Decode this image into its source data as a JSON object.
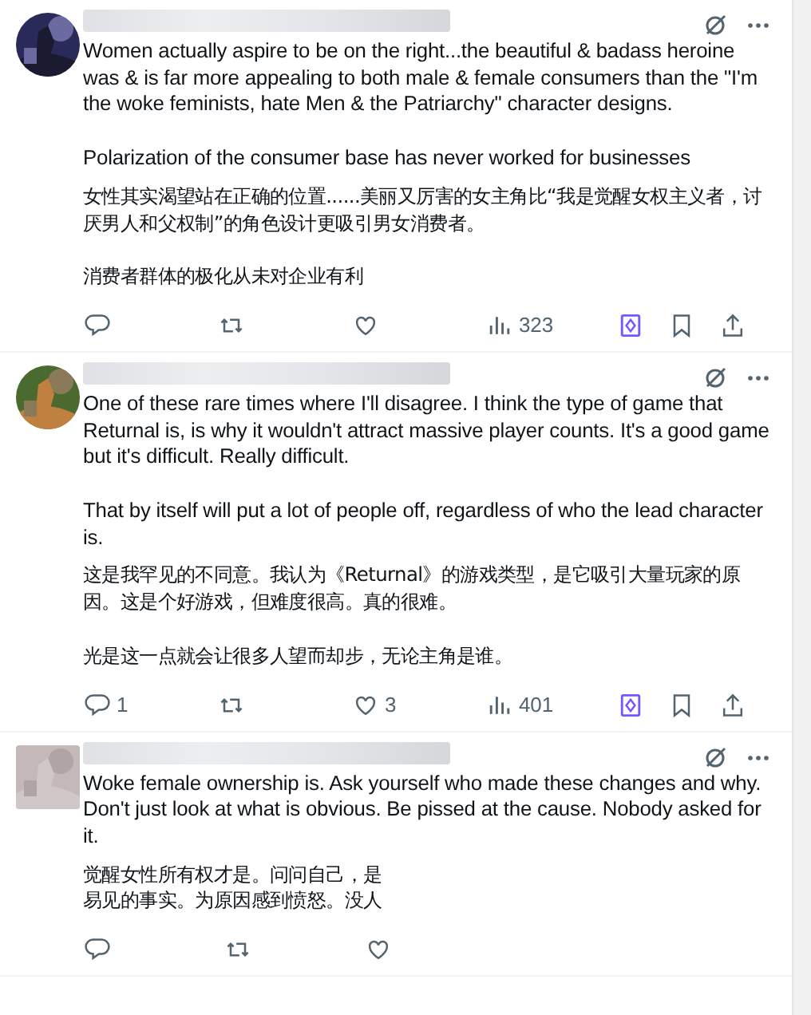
{
  "tweets": [
    {
      "paragraphs": [
        {
          "kind": "en",
          "text": "Women actually aspire to be on the right...the beautiful & badass heroine was & is far more appealing to both male & female consumers than the \"I'm the woke feminists, hate Men & the Patriarchy\" character designs."
        },
        {
          "kind": "en",
          "text": "Polarization of the consumer base has never worked for businesses"
        },
        {
          "kind": "zh",
          "text": "女性其实渴望站在正确的位置......美丽又厉害的女主角比“我是觉醒女权主义者，讨厌男人和父权制”的角色设计更吸引男女消费者。"
        },
        {
          "kind": "zh",
          "text": "消费者群体的极化从未对企业有利"
        }
      ],
      "actions": [
        {
          "kind": "reply"
        },
        {
          "kind": "repost"
        },
        {
          "kind": "like"
        },
        {
          "kind": "views",
          "count": "323"
        },
        {
          "kind": "grok"
        },
        {
          "kind": "bookmark"
        },
        {
          "kind": "share"
        }
      ]
    },
    {
      "paragraphs": [
        {
          "kind": "en",
          "text": "One of these rare times where I'll disagree. I think the type of game that Returnal is, is why it wouldn't attract massive player counts. It's a good game but it's difficult. Really difficult."
        },
        {
          "kind": "en",
          "text": "That by itself will put a lot of people off, regardless of who the lead character is."
        },
        {
          "kind": "zh",
          "text": "这是我罕见的不同意。我认为《Returnal》的游戏类型，是它吸引大量玩家的原因。这是个好游戏，但难度很高。真的很难。"
        },
        {
          "kind": "zh",
          "text": "光是这一点就会让很多人望而却步，无论主角是谁。"
        }
      ],
      "actions": [
        {
          "kind": "reply",
          "count": "1"
        },
        {
          "kind": "repost"
        },
        {
          "kind": "like",
          "count": "3"
        },
        {
          "kind": "views",
          "count": "401"
        },
        {
          "kind": "grok"
        },
        {
          "kind": "bookmark"
        },
        {
          "kind": "share"
        }
      ]
    },
    {
      "paragraphs": [
        {
          "kind": "en",
          "text": "Woke female ownership is. Ask yourself who made these changes and why. Don't just look at what is obvious. Be pissed at the cause. Nobody asked for it."
        },
        {
          "kind": "zh",
          "lines": [
            "觉醒女性所有权才是。问问自己，是",
            "易见的事实。为原因感到愤怒。没人"
          ]
        }
      ],
      "actions": [
        {
          "kind": "reply"
        },
        {
          "kind": "repost"
        },
        {
          "kind": "like"
        }
      ]
    }
  ]
}
